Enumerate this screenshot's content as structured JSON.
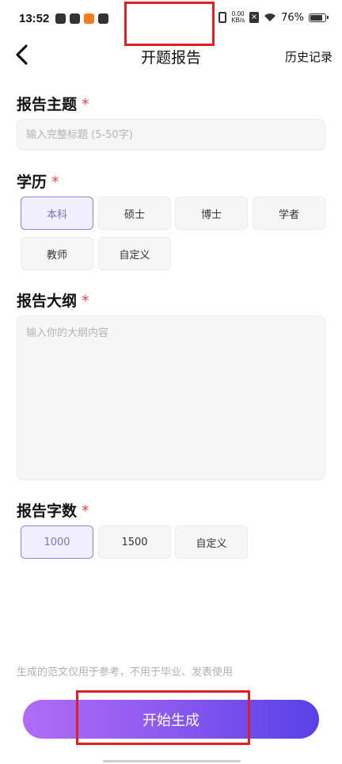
{
  "status_bar": {
    "time": "13:52",
    "net_speed": "0.00",
    "net_unit": "KB/s",
    "battery": "76%"
  },
  "header": {
    "title": "开题报告",
    "history_label": "历史记录"
  },
  "topic": {
    "label": "报告主题",
    "required_mark": "*",
    "placeholder": "输入完整标题 (5-50字)"
  },
  "education": {
    "label": "学历",
    "required_mark": "*",
    "options": [
      "本科",
      "硕士",
      "博士",
      "学者",
      "教师",
      "自定义"
    ],
    "selected": "本科"
  },
  "outline": {
    "label": "报告大纲",
    "required_mark": "*",
    "placeholder": "输入你的大纲内容"
  },
  "word_count": {
    "label": "报告字数",
    "required_mark": "*",
    "options": [
      "1000",
      "1500",
      "自定义"
    ],
    "selected": "1000"
  },
  "disclaimer": "生成的范文仅用于参考，不用于毕业、发表使用",
  "generate_button": "开始生成",
  "colors": {
    "accent": "#7a72c6",
    "required": "#e04a4a",
    "gradient_start": "#b06cf4",
    "gradient_end": "#5840e8",
    "highlight_box": "#e02020"
  }
}
